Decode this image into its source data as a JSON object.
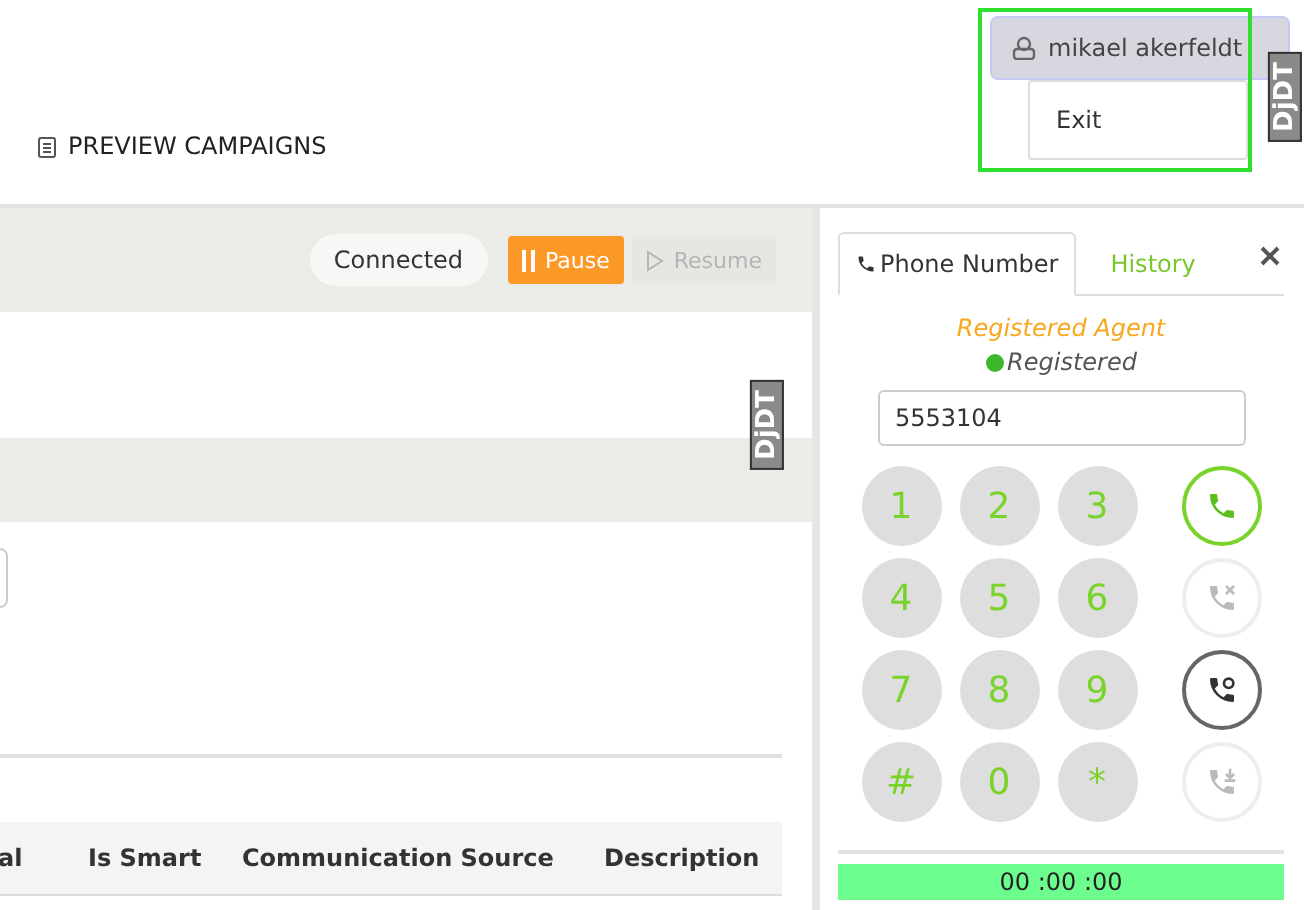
{
  "header": {
    "nav_link": "PREVIEW CAMPAIGNS",
    "user_menu": {
      "user": "mikael akerfeldt",
      "expanded": true,
      "items": [
        "Exit"
      ]
    }
  },
  "debug_badges": [
    "DjDT",
    "DjDT"
  ],
  "toolbar": {
    "status": "Connected",
    "buttons": [
      {
        "label": "Pause",
        "kind": "pause",
        "disabled": false
      },
      {
        "label": "Resume",
        "kind": "resume",
        "disabled": true
      }
    ]
  },
  "table": {
    "columns": [
      "al",
      "Is Smart",
      "Communication Source",
      "Description"
    ]
  },
  "phone": {
    "tabs": [
      {
        "label": "Phone Number",
        "selected": true
      },
      {
        "label": "History",
        "selected": false
      }
    ],
    "agent_status": "Registered Agent",
    "registration": "Registered",
    "number": "5553104",
    "keys": [
      "1",
      "2",
      "3",
      "4",
      "5",
      "6",
      "7",
      "8",
      "9",
      "#",
      "0",
      "*"
    ],
    "actions": [
      {
        "kind": "call",
        "disabled": false
      },
      {
        "kind": "hangup",
        "disabled": true
      },
      {
        "kind": "transfer",
        "disabled": false
      },
      {
        "kind": "conference",
        "disabled": true
      }
    ],
    "timer": "00 :00 :00"
  }
}
